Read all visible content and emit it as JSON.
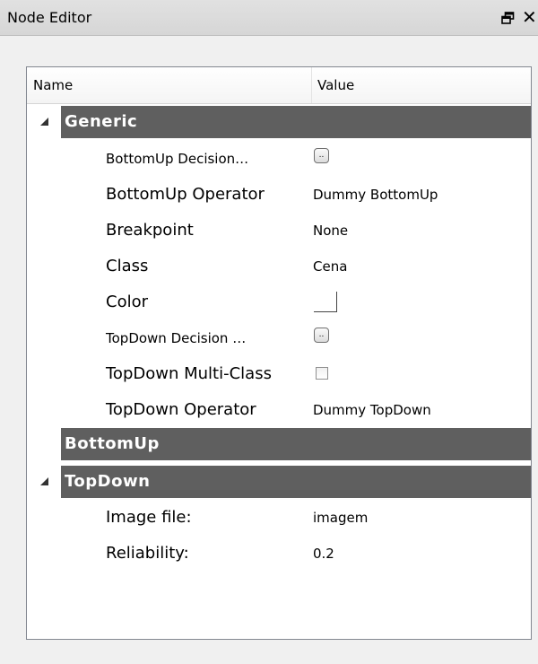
{
  "window": {
    "title": "Node Editor",
    "float_icon": "float-window-icon",
    "close_glyph": "✕"
  },
  "grid": {
    "columns": {
      "name": "Name",
      "value": "Value"
    },
    "categories": {
      "generic": {
        "label": "Generic",
        "expanded": true,
        "properties": {
          "bottomup_decision": {
            "name": "BottomUp Decision…"
          },
          "bottomup_operator": {
            "name": "BottomUp Operator",
            "value": "Dummy BottomUp"
          },
          "breakpoint": {
            "name": "Breakpoint",
            "value": "None"
          },
          "class": {
            "name": "Class",
            "value": "Cena"
          },
          "color": {
            "name": "Color",
            "swatch": "#ffffff"
          },
          "topdown_decision": {
            "name": "TopDown Decision …"
          },
          "topdown_multiclass": {
            "name": "TopDown Multi-Class",
            "checked": false
          },
          "topdown_operator": {
            "name": "TopDown Operator",
            "value": "Dummy TopDown"
          }
        }
      },
      "bottomup": {
        "label": "BottomUp",
        "expanded": false
      },
      "topdown": {
        "label": "TopDown",
        "expanded": true,
        "properties": {
          "image_file": {
            "name": "Image file:",
            "value": "imagem"
          },
          "reliability": {
            "name": "Reliability:",
            "value": "0.2"
          }
        }
      }
    },
    "ellipsis_label": "..",
    "category_color": "#5f5f5f"
  }
}
